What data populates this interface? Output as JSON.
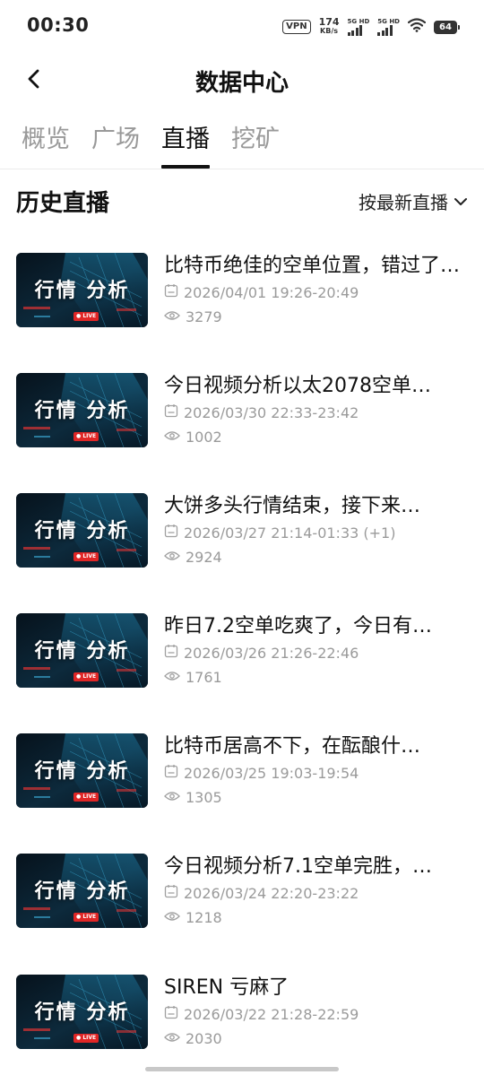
{
  "status_bar": {
    "time": "00:30",
    "vpn": "VPN",
    "net_speed": "174",
    "net_unit": "KB/s",
    "sig1": "5G HD",
    "sig2": "5G HD",
    "battery": "64"
  },
  "header": {
    "title": "数据中心"
  },
  "tabs": [
    {
      "label": "概览",
      "active": false
    },
    {
      "label": "广场",
      "active": false
    },
    {
      "label": "直播",
      "active": true
    },
    {
      "label": "挖矿",
      "active": false
    }
  ],
  "section": {
    "title": "历史直播",
    "sort_label": "按最新直播"
  },
  "thumbnail": {
    "title": "行情 分析",
    "live": "● LIVE"
  },
  "broadcasts": [
    {
      "title": "比特币绝佳的空单位置，错过了…",
      "time": "2026/04/01 19:26-20:49",
      "views": "3279"
    },
    {
      "title": "今日视频分析以太2078空单…",
      "time": "2026/03/30 22:33-23:42",
      "views": "1002"
    },
    {
      "title": "大饼多头行情结束，接下来…",
      "time": "2026/03/27 21:14-01:33 (+1)",
      "views": "2924"
    },
    {
      "title": "昨日7.2空单吃爽了，今日有…",
      "time": "2026/03/26 21:26-22:46",
      "views": "1761"
    },
    {
      "title": "比特币居高不下，在酝酿什…",
      "time": "2026/03/25 19:03-19:54",
      "views": "1305"
    },
    {
      "title": "今日视频分析7.1空单完胜，…",
      "time": "2026/03/24 22:20-23:22",
      "views": "1218"
    },
    {
      "title": "SIREN 亏麻了",
      "time": "2026/03/22 21:28-22:59",
      "views": "2030"
    }
  ]
}
